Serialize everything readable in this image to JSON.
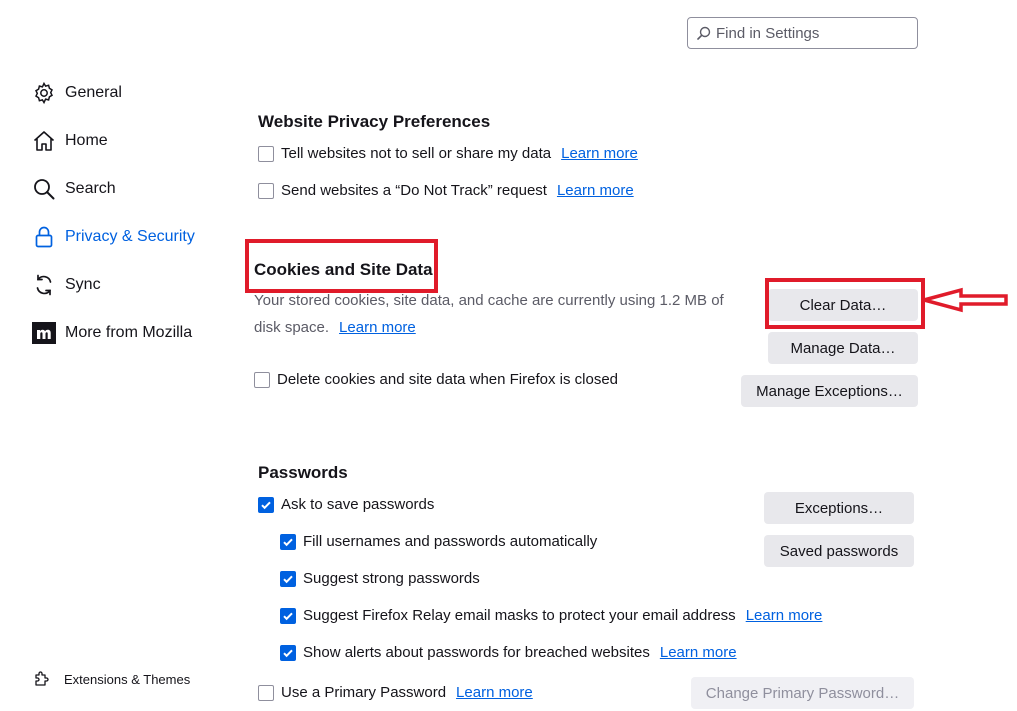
{
  "search": {
    "placeholder": "Find in Settings"
  },
  "sidebar": {
    "items": [
      {
        "label": "General",
        "icon": "gear-icon"
      },
      {
        "label": "Home",
        "icon": "home-icon"
      },
      {
        "label": "Search",
        "icon": "search-icon"
      },
      {
        "label": "Privacy & Security",
        "icon": "lock-icon",
        "active": true
      },
      {
        "label": "Sync",
        "icon": "sync-icon"
      },
      {
        "label": "More from Mozilla",
        "icon": "mozilla-icon"
      }
    ],
    "footer": {
      "label": "Extensions & Themes",
      "icon": "puzzle-icon"
    }
  },
  "website_privacy": {
    "title": "Website Privacy Preferences",
    "options": [
      {
        "label": "Tell websites not to sell or share my data",
        "checked": false,
        "link": "Learn more"
      },
      {
        "label": "Send websites a “Do Not Track” request",
        "checked": false,
        "link": "Learn more"
      }
    ]
  },
  "cookies": {
    "title": "Cookies and Site Data",
    "description": "Your stored cookies, site data, and cache are currently using 1.2 MB of disk space.",
    "description_line1": "Your stored cookies, site data, and cache are currently using 1.2 MB of",
    "description_line2": "disk space.",
    "link": "Learn more",
    "buttons": {
      "clear": "Clear Data…",
      "manage": "Manage Data…",
      "exceptions": "Manage Exceptions…"
    },
    "delete_on_close": {
      "label": "Delete cookies and site data when Firefox is closed",
      "checked": false
    }
  },
  "passwords": {
    "title": "Passwords",
    "ask_to_save": {
      "label": "Ask to save passwords",
      "checked": true
    },
    "fill_auto": {
      "label": "Fill usernames and passwords automatically",
      "checked": true
    },
    "suggest_strong": {
      "label": "Suggest strong passwords",
      "checked": true
    },
    "relay": {
      "label": "Suggest Firefox Relay email masks to protect your email address",
      "checked": true,
      "link": "Learn more"
    },
    "breach_alerts": {
      "label": "Show alerts about passwords for breached websites",
      "checked": true,
      "link": "Learn more"
    },
    "primary_password": {
      "label": "Use a Primary Password",
      "checked": false,
      "link": "Learn more"
    },
    "buttons": {
      "exceptions": "Exceptions…",
      "saved": "Saved passwords",
      "change_primary": "Change Primary Password…"
    }
  },
  "annotation": {
    "color": "#e01b2a"
  },
  "colors": {
    "accent": "#0061e0",
    "text": "#15141a",
    "button_bg": "#e8e8ec"
  }
}
